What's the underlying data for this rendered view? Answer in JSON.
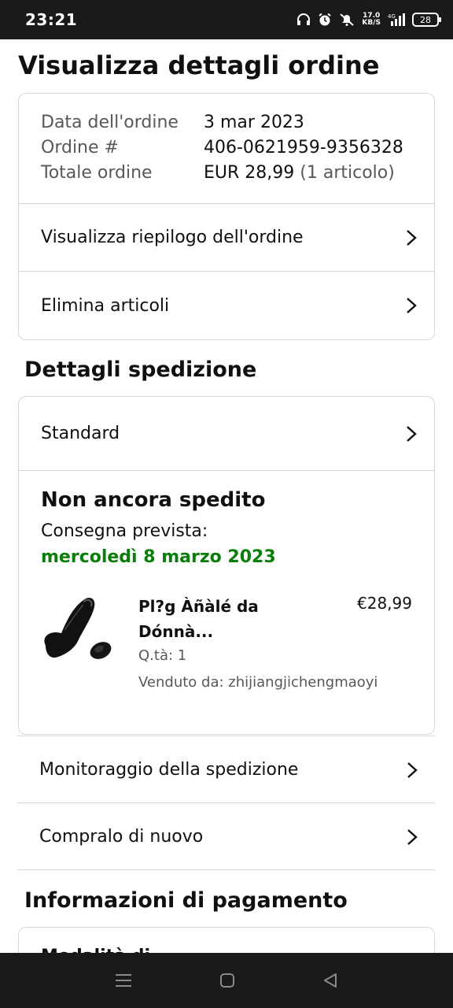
{
  "status_bar": {
    "time": "23:21",
    "net_speed_value": "17.0",
    "net_speed_unit": "KB/S",
    "network": "4G",
    "battery": "28"
  },
  "page": {
    "title": "Visualizza dettagli ordine"
  },
  "order": {
    "date_label": "Data dell'ordine",
    "date_value": "3 mar 2023",
    "number_label": "Ordine #",
    "number_value": "406-0621959-9356328",
    "total_label": "Totale ordine",
    "total_value": "EUR 28,99",
    "total_items": "(1 articolo)",
    "summary_link": "Visualizza riepilogo dell'ordine",
    "delete_items_link": "Elimina articoli"
  },
  "shipping": {
    "section_title": "Dettagli spedizione",
    "method": "Standard",
    "status": "Non ancora spedito",
    "delivery_label": "Consegna prevista:",
    "delivery_date": "mercoledì 8 marzo 2023",
    "product": {
      "title": "Pl?g Àñàlé da Dónnà...",
      "price": "€28,99",
      "quantity": "Q.tà: 1",
      "seller": "Venduto da: zhijiangjichengmaoyi"
    },
    "track_link": "Monitoraggio della spedizione",
    "buy_again_link": "Compralo di nuovo"
  },
  "payment": {
    "section_title": "Informazioni di pagamento",
    "method_label": "Modalità di"
  },
  "colors": {
    "delivery_green": "#0a7d0a",
    "border": "#d5d9d9",
    "muted_text": "#565959"
  }
}
